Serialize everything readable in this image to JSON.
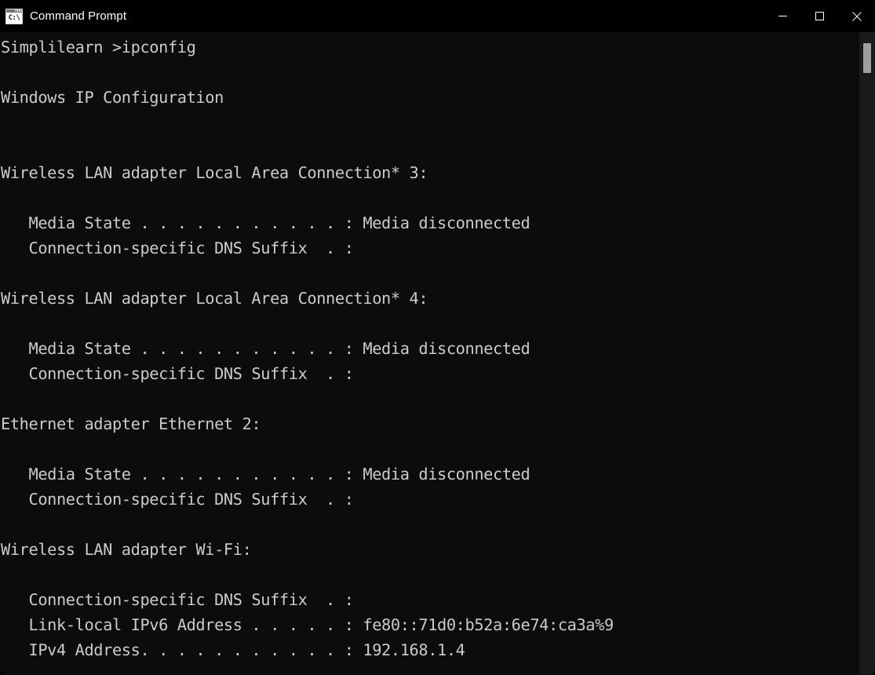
{
  "window": {
    "title": "Command Prompt",
    "icon": "command-prompt-icon",
    "icon_glyph": "C:\\",
    "background_color": "#0c0c0c",
    "titlebar_color": "#000000",
    "text_color": "#ccccd0"
  },
  "titlebar_controls": {
    "minimize_label": "Minimize",
    "maximize_label": "Maximize",
    "close_label": "Close"
  },
  "scrollbar": {
    "thumb_color": "#9e9e9e",
    "track_color": "#1a1a1a"
  },
  "console": {
    "prompt_line": "Simplilearn >ipconfig",
    "command": "ipconfig",
    "prompt_prefix": "Simplilearn >",
    "output": "Simplilearn >ipconfig\n\nWindows IP Configuration\n\n\nWireless LAN adapter Local Area Connection* 3:\n\n   Media State . . . . . . . . . . . : Media disconnected\n   Connection-specific DNS Suffix  . :\n\nWireless LAN adapter Local Area Connection* 4:\n\n   Media State . . . . . . . . . . . : Media disconnected\n   Connection-specific DNS Suffix  . :\n\nEthernet adapter Ethernet 2:\n\n   Media State . . . . . . . . . . . : Media disconnected\n   Connection-specific DNS Suffix  . :\n\nWireless LAN adapter Wi-Fi:\n\n   Connection-specific DNS Suffix  . :\n   Link-local IPv6 Address . . . . . : fe80::71d0:b52a:6e74:ca3a%9\n   IPv4 Address. . . . . . . . . . . : 192.168.1.4",
    "section_header": "Windows IP Configuration",
    "adapters": [
      {
        "name": "Wireless LAN adapter Local Area Connection* 3:",
        "fields": [
          {
            "label": "Media State",
            "value": "Media disconnected"
          },
          {
            "label": "Connection-specific DNS Suffix",
            "value": ""
          }
        ]
      },
      {
        "name": "Wireless LAN adapter Local Area Connection* 4:",
        "fields": [
          {
            "label": "Media State",
            "value": "Media disconnected"
          },
          {
            "label": "Connection-specific DNS Suffix",
            "value": ""
          }
        ]
      },
      {
        "name": "Ethernet adapter Ethernet 2:",
        "fields": [
          {
            "label": "Media State",
            "value": "Media disconnected"
          },
          {
            "label": "Connection-specific DNS Suffix",
            "value": ""
          }
        ]
      },
      {
        "name": "Wireless LAN adapter Wi-Fi:",
        "fields": [
          {
            "label": "Connection-specific DNS Suffix",
            "value": ""
          },
          {
            "label": "Link-local IPv6 Address",
            "value": "fe80::71d0:b52a:6e74:ca3a%9"
          },
          {
            "label": "IPv4 Address",
            "value": "192.168.1.4"
          }
        ]
      }
    ]
  }
}
